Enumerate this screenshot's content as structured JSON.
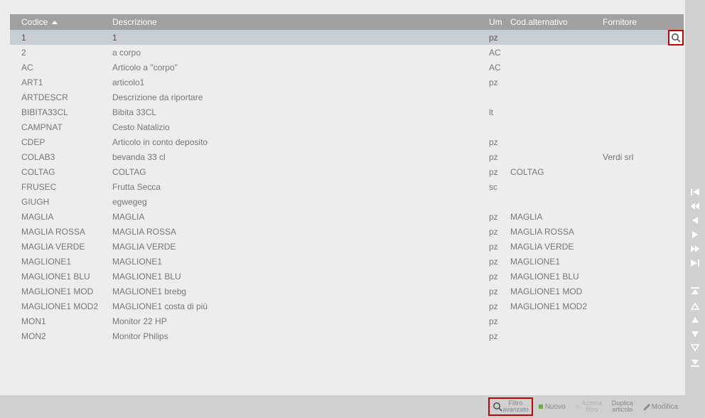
{
  "columns": {
    "codice": "Codice",
    "descrizione": "Descrizione",
    "um": "Um",
    "codalt": "Cod.alternativo",
    "fornitore": "Fornitore"
  },
  "rows": [
    {
      "codice": "1",
      "descr": "1",
      "um": "pz",
      "alt": "",
      "forn": ""
    },
    {
      "codice": "2",
      "descr": "a corpo",
      "um": "AC",
      "alt": "",
      "forn": ""
    },
    {
      "codice": "AC",
      "descr": "Articolo a \"corpo\"",
      "um": "AC",
      "alt": "",
      "forn": ""
    },
    {
      "codice": "ART1",
      "descr": "articolo1",
      "um": "pz",
      "alt": "",
      "forn": ""
    },
    {
      "codice": "ARTDESCR",
      "descr": "Descrizione da riportare",
      "um": "",
      "alt": "",
      "forn": ""
    },
    {
      "codice": "BIBITA33CL",
      "descr": "Bibita 33CL",
      "um": "lt",
      "alt": "",
      "forn": ""
    },
    {
      "codice": "CAMPNAT",
      "descr": "Cesto Natalizio",
      "um": "",
      "alt": "",
      "forn": ""
    },
    {
      "codice": "CDEP",
      "descr": "Articolo in conto deposito",
      "um": "pz",
      "alt": "",
      "forn": ""
    },
    {
      "codice": "COLAB3",
      "descr": "bevanda 33 cl",
      "um": "pz",
      "alt": "",
      "forn": "Verdi srl"
    },
    {
      "codice": "COLTAG",
      "descr": "COLTAG",
      "um": "pz",
      "alt": "COLTAG",
      "forn": ""
    },
    {
      "codice": "FRUSEC",
      "descr": "Frutta Secca",
      "um": "sc",
      "alt": "",
      "forn": ""
    },
    {
      "codice": "GIUGH",
      "descr": "egwegeg",
      "um": "",
      "alt": "",
      "forn": ""
    },
    {
      "codice": "MAGLIA",
      "descr": "MAGLIA",
      "um": "pz",
      "alt": "MAGLIA",
      "forn": ""
    },
    {
      "codice": "MAGLIA    ROSSA",
      "descr": "MAGLIA ROSSA",
      "um": "pz",
      "alt": "MAGLIA ROSSA",
      "forn": ""
    },
    {
      "codice": "MAGLIA    VERDE",
      "descr": "MAGLIA VERDE",
      "um": "pz",
      "alt": "MAGLIA VERDE",
      "forn": ""
    },
    {
      "codice": "MAGLIONE1",
      "descr": "MAGLIONE1",
      "um": "pz",
      "alt": "MAGLIONE1",
      "forn": ""
    },
    {
      "codice": "MAGLIONE1 BLU",
      "descr": "MAGLIONE1 BLU",
      "um": "pz",
      "alt": "MAGLIONE1 BLU",
      "forn": ""
    },
    {
      "codice": "MAGLIONE1 MOD",
      "descr": "MAGLIONE1 brebg",
      "um": "pz",
      "alt": "MAGLIONE1 MOD",
      "forn": ""
    },
    {
      "codice": "MAGLIONE1 MOD2",
      "descr": "MAGLIONE1 costa di più",
      "um": "pz",
      "alt": "MAGLIONE1 MOD2",
      "forn": ""
    },
    {
      "codice": "MON1",
      "descr": "Monitor 22 HP",
      "um": "pz",
      "alt": "",
      "forn": ""
    },
    {
      "codice": "MON2",
      "descr": "Monitor Philips",
      "um": "pz",
      "alt": "",
      "forn": ""
    }
  ],
  "selected_row_index": 0,
  "toolbar": {
    "filtro1": "Filtro",
    "filtro2": "avanzato",
    "nuovo": "Nuovo",
    "azzera1": "Azzera",
    "azzera2": "filtro",
    "duplica1": "Duplica",
    "duplica2": "articolo",
    "modifica": "Modifica"
  },
  "colors": {
    "highlight_border": "#c00400",
    "nuovo_square": "#6fae3c"
  }
}
